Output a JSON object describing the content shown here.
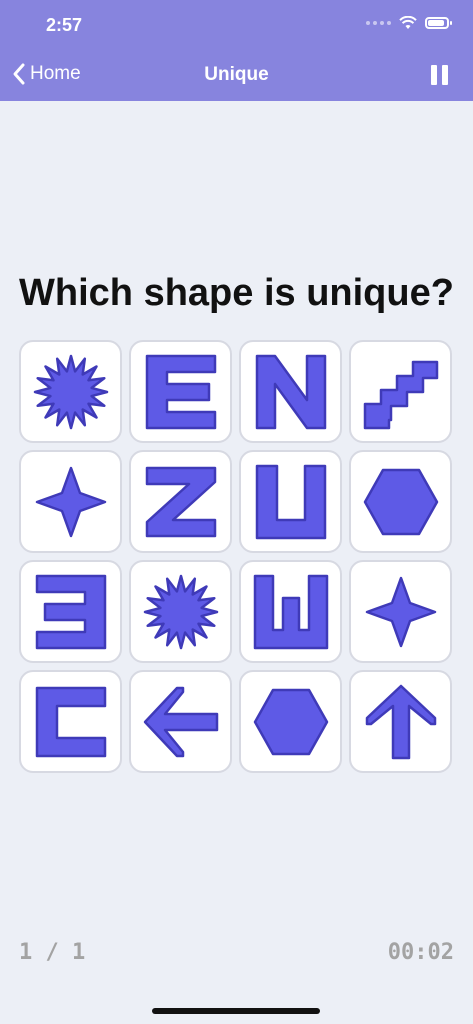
{
  "status_bar": {
    "time": "2:57"
  },
  "nav": {
    "back_label": "Home",
    "title": "Unique"
  },
  "question": "Which shape is unique?",
  "colors": {
    "accent": "#8784de",
    "shape_fill": "#5e5ae6",
    "shape_stroke": "#3f3ab8"
  },
  "tiles": [
    {
      "shape": "starburst"
    },
    {
      "shape": "letter-e"
    },
    {
      "shape": "letter-n"
    },
    {
      "shape": "stairs"
    },
    {
      "shape": "four-point-star"
    },
    {
      "shape": "letter-z"
    },
    {
      "shape": "letter-u"
    },
    {
      "shape": "hexagon"
    },
    {
      "shape": "reversed-e"
    },
    {
      "shape": "starburst"
    },
    {
      "shape": "letter-w"
    },
    {
      "shape": "four-point-star"
    },
    {
      "shape": "letter-c"
    },
    {
      "shape": "arrow-left"
    },
    {
      "shape": "hexagon"
    },
    {
      "shape": "arrow-up"
    }
  ],
  "footer": {
    "progress": "1 / 1",
    "timer": "00:02"
  }
}
